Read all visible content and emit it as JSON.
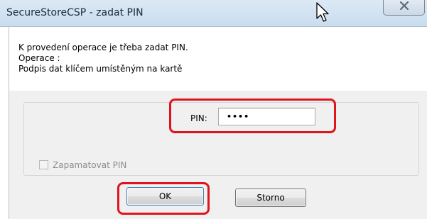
{
  "window": {
    "title": "SecureStoreCSP - zadat PIN",
    "close_icon": "close-icon"
  },
  "message": {
    "line1": "K provedení operace je třeba zadat PIN.",
    "line2": "Operace :",
    "line3": "Podpis dat klíčem umístěným na kartě"
  },
  "pin": {
    "label": "PIN:",
    "value": "••••"
  },
  "remember": {
    "label": "Zapamatovat PIN",
    "checked": false,
    "enabled": false
  },
  "buttons": {
    "ok": "OK",
    "cancel": "Storno"
  },
  "colors": {
    "highlight": "#e0141c",
    "title_bar": "#dce9f5",
    "dialog_bg": "#f0f0f0"
  }
}
